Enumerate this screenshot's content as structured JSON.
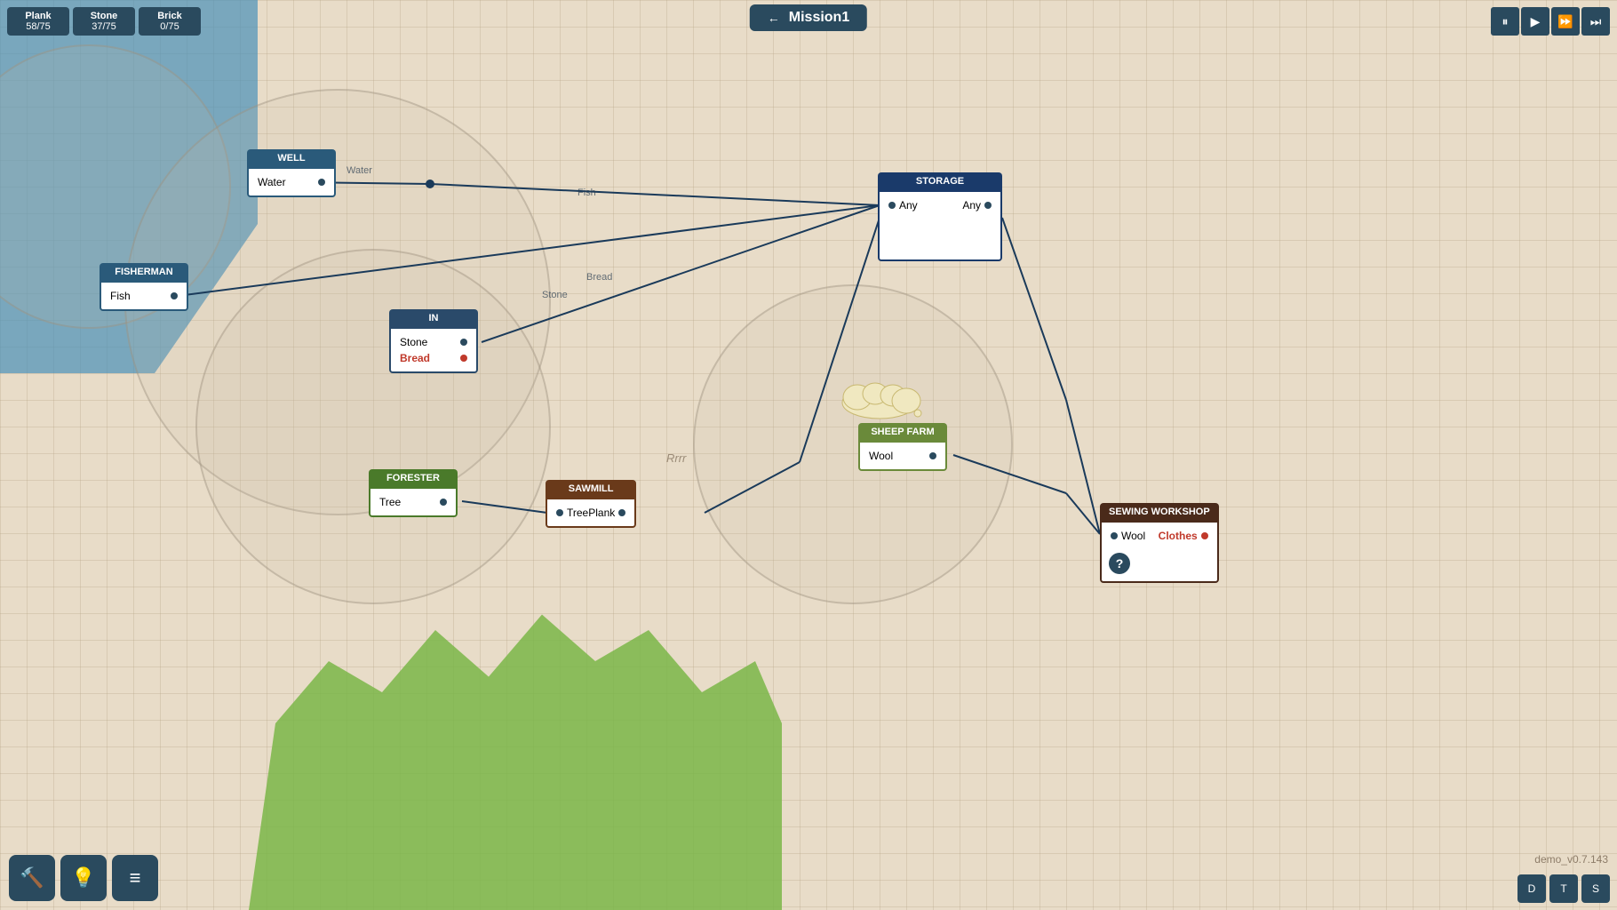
{
  "title": "Mission1",
  "resources": [
    {
      "name": "Plank",
      "current": 58,
      "max": 75
    },
    {
      "name": "Stone",
      "current": 37,
      "max": 75
    },
    {
      "name": "Brick",
      "current": 0,
      "max": 75
    }
  ],
  "playback": {
    "pause": "⏸",
    "play": "▶",
    "fast": "⏩",
    "skip": "⏭"
  },
  "nodes": {
    "well": {
      "title": "WELL",
      "output": "Water"
    },
    "fisherman": {
      "title": "FISHERMAN",
      "output": "Fish"
    },
    "in": {
      "title": "IN",
      "input1": "Stone",
      "input2": "Bread"
    },
    "storage": {
      "title": "STORAGE",
      "input": "Any",
      "output": "Any"
    },
    "sheepfarm": {
      "title": "SHEEP FARM",
      "output": "Wool"
    },
    "forester": {
      "title": "FORESTER",
      "output": "Tree"
    },
    "sawmill": {
      "title": "SAWMILL",
      "input": "Tree",
      "output": "Plank"
    },
    "sewing": {
      "title": "SEWING WORKSHOP",
      "input": "Wool",
      "output": "Clothes"
    }
  },
  "labels": {
    "rrrr": "Rrrr",
    "stone_bread": "Stone Bread",
    "water": "Water",
    "fish": "Fish"
  },
  "toolbar": {
    "hammer": "🔨",
    "bulb": "💡",
    "menu": "≡"
  },
  "version": "demo_v0.7.143",
  "social": {
    "discord": "D",
    "twitter": "T",
    "steam": "S"
  }
}
